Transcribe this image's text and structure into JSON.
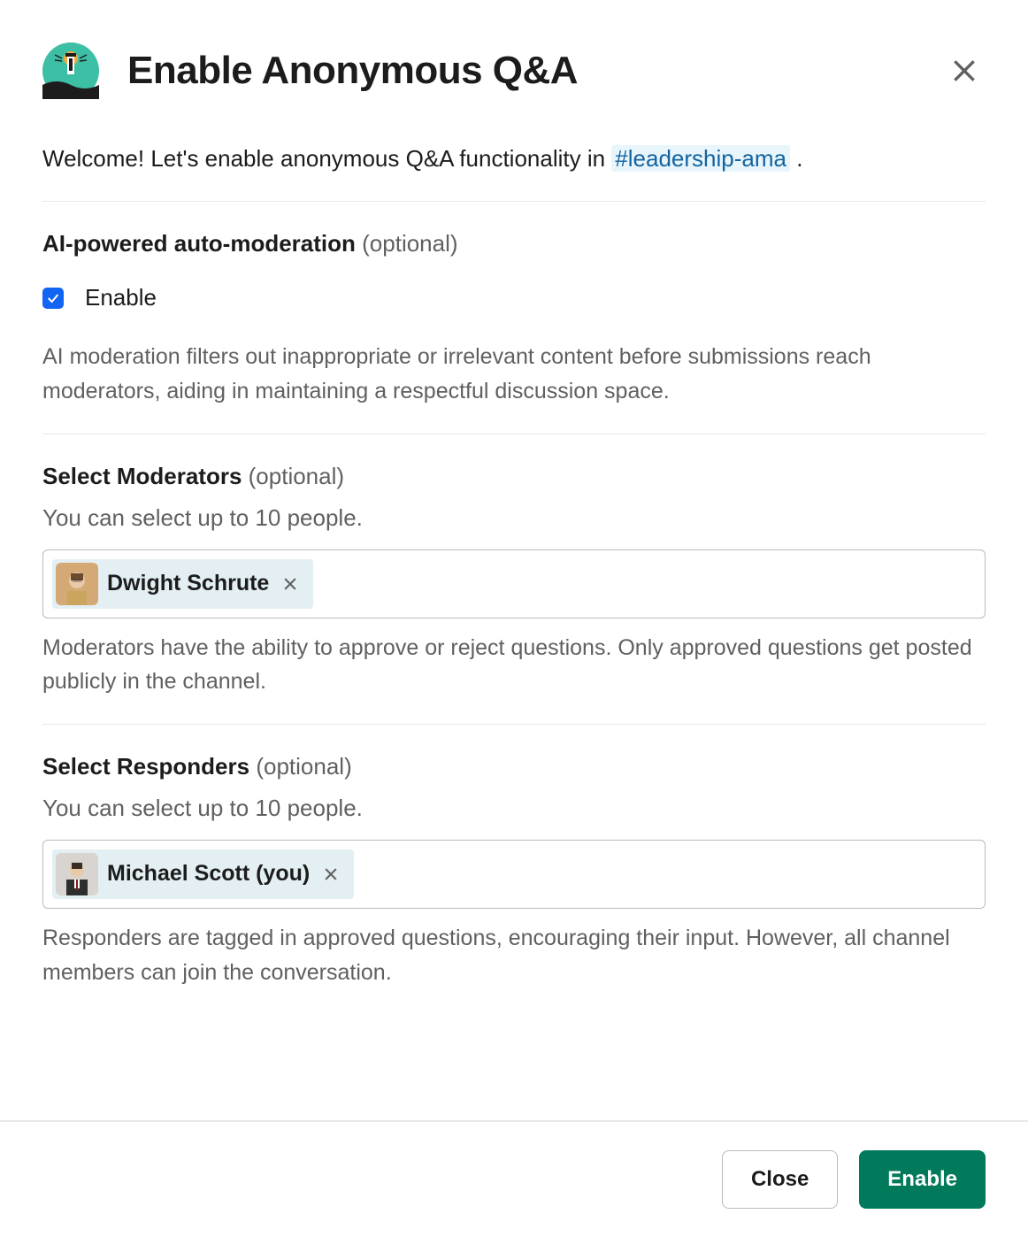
{
  "modal": {
    "title": "Enable Anonymous Q&A",
    "intro_pre": "Welcome! Let's enable anonymous Q&A functionality in ",
    "channel": "#leadership-ama",
    "intro_post": " ."
  },
  "ai_moderation": {
    "title": "AI-powered auto-moderation",
    "optional": "(optional)",
    "checkbox_label": "Enable",
    "checked": true,
    "description": "AI moderation filters out inappropriate or irrelevant content before submissions reach moderators, aiding in maintaining a respectful discussion space."
  },
  "moderators": {
    "title": "Select Moderators",
    "optional": "(optional)",
    "sub": "You can select up to 10 people.",
    "selected": [
      {
        "name": "Dwight Schrute"
      }
    ],
    "description": "Moderators have the ability to approve or reject questions. Only approved questions get posted publicly in the channel."
  },
  "responders": {
    "title": "Select Responders",
    "optional": "(optional)",
    "sub": "You can select up to 10 people.",
    "selected": [
      {
        "name": "Michael Scott (you)"
      }
    ],
    "description": "Responders are tagged in approved questions, encouraging their input. However, all channel members can join the conversation."
  },
  "footer": {
    "close": "Close",
    "enable": "Enable"
  }
}
